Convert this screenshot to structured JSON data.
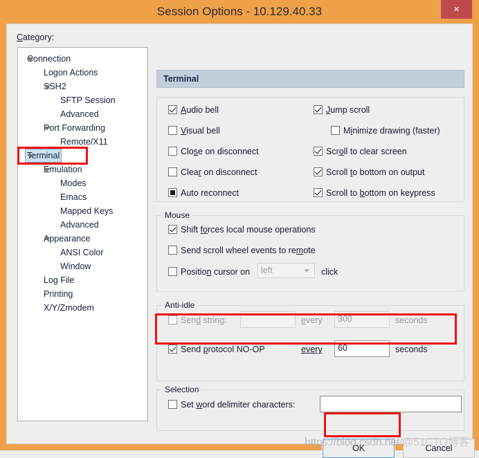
{
  "window": {
    "title": "Session Options - 10.129.40.33",
    "close_label": "×",
    "accent_orange": "#efa14a",
    "close_red": "#bf4a4a",
    "annotation_red": "#ee1111"
  },
  "category": {
    "label": "Category:",
    "items": [
      {
        "label": "Connection",
        "indent": 0,
        "arrow": "open",
        "selected": false
      },
      {
        "label": "Logon Actions",
        "indent": 1,
        "arrow": "none",
        "selected": false
      },
      {
        "label": "SSH2",
        "indent": 1,
        "arrow": "open",
        "selected": false
      },
      {
        "label": "SFTP Session",
        "indent": 2,
        "arrow": "none",
        "selected": false
      },
      {
        "label": "Advanced",
        "indent": 2,
        "arrow": "none",
        "selected": false
      },
      {
        "label": "Port Forwarding",
        "indent": 1,
        "arrow": "open",
        "selected": false
      },
      {
        "label": "Remote/X11",
        "indent": 2,
        "arrow": "none",
        "selected": false
      },
      {
        "label": "Terminal",
        "indent": 0,
        "arrow": "open",
        "selected": true
      },
      {
        "label": "Emulation",
        "indent": 1,
        "arrow": "open",
        "selected": false
      },
      {
        "label": "Modes",
        "indent": 2,
        "arrow": "none",
        "selected": false
      },
      {
        "label": "Emacs",
        "indent": 2,
        "arrow": "none",
        "selected": false
      },
      {
        "label": "Mapped Keys",
        "indent": 2,
        "arrow": "none",
        "selected": false
      },
      {
        "label": "Advanced",
        "indent": 2,
        "arrow": "none",
        "selected": false
      },
      {
        "label": "Appearance",
        "indent": 1,
        "arrow": "open",
        "selected": false
      },
      {
        "label": "ANSI Color",
        "indent": 2,
        "arrow": "none",
        "selected": false
      },
      {
        "label": "Window",
        "indent": 2,
        "arrow": "none",
        "selected": false
      },
      {
        "label": "Log File",
        "indent": 1,
        "arrow": "none",
        "selected": false
      },
      {
        "label": "Printing",
        "indent": 1,
        "arrow": "none",
        "selected": false
      },
      {
        "label": "X/Y/Zmodem",
        "indent": 1,
        "arrow": "none",
        "selected": false
      }
    ]
  },
  "panel": {
    "header": "Terminal",
    "general": {
      "left_column": [
        {
          "label": "Audio bell",
          "state": "checked",
          "accel": "A"
        },
        {
          "label": "Visual bell",
          "state": "unchecked",
          "accel": "V"
        },
        {
          "label": "Close on disconnect",
          "state": "unchecked",
          "accel": "s"
        },
        {
          "label": "Clear on disconnect",
          "state": "unchecked",
          "accel": "r"
        },
        {
          "label": "Auto reconnect",
          "state": "indeterminate",
          "accel": ""
        }
      ],
      "right_column": [
        {
          "label": "Jump scroll",
          "state": "checked",
          "accel": "J",
          "indent": 0
        },
        {
          "label": "Minimize drawing (faster)",
          "state": "unchecked",
          "accel": "i",
          "indent": 1
        },
        {
          "label": "Scroll to clear screen",
          "state": "checked",
          "accel": "o",
          "indent": 0
        },
        {
          "label": "Scroll to bottom on output",
          "state": "checked",
          "accel": "t",
          "indent": 0
        },
        {
          "label": "Scroll to bottom on keypress",
          "state": "checked",
          "accel": "b",
          "indent": 0
        }
      ]
    },
    "mouse": {
      "title": "Mouse",
      "rows": [
        {
          "label": "Shift forces local mouse operations",
          "state": "checked",
          "accel": "fo"
        },
        {
          "label": "Send scroll wheel events to remote",
          "state": "unchecked",
          "accel": "m"
        },
        {
          "label": "Position cursor on",
          "state": "unchecked",
          "accel": "n"
        }
      ],
      "position_combo_value": "left",
      "position_suffix": "click"
    },
    "antiidle": {
      "title": "Anti-idle",
      "send_string": {
        "label": "Send string:",
        "state": "unchecked",
        "disabled": true,
        "value": "",
        "every_label": "every",
        "interval": "300",
        "seconds_label": "seconds"
      },
      "send_noop": {
        "label": "Send protocol NO-OP",
        "state": "checked",
        "disabled": false,
        "every_label": "every",
        "interval": "60",
        "seconds_label": "seconds",
        "highlighted": true
      }
    },
    "selection": {
      "title": "Selection",
      "label": "Set word delimiter characters:",
      "state": "unchecked",
      "value": ""
    }
  },
  "buttons": {
    "ok": "OK",
    "cancel": "Cancel"
  },
  "watermark": {
    "part1": "https://blog.csdn.net",
    "part2": "/@51CTO博客"
  }
}
